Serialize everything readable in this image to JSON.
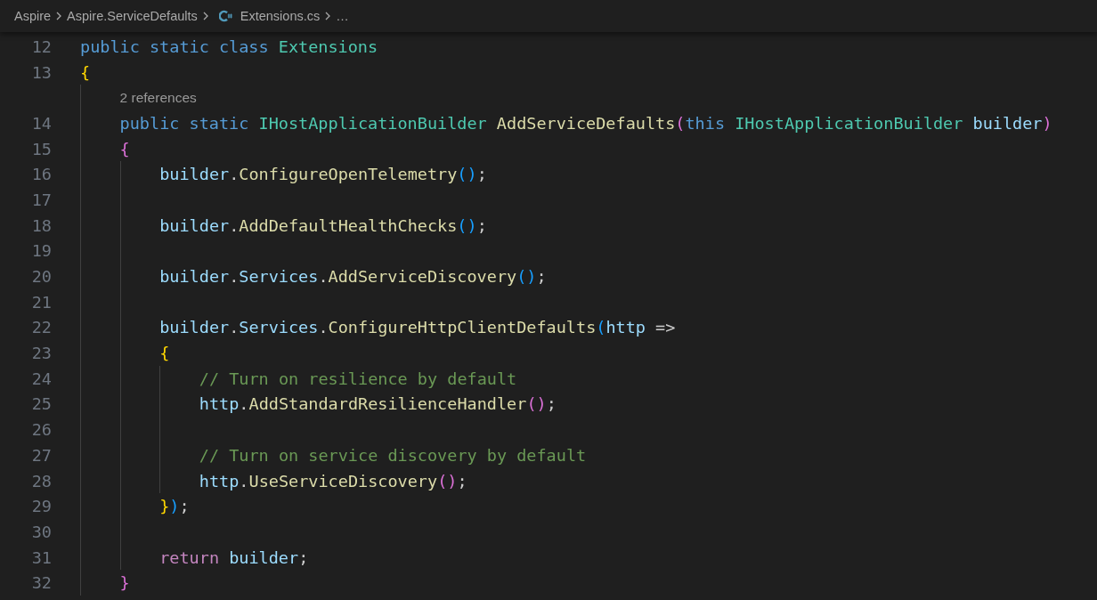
{
  "breadcrumb": {
    "items": [
      {
        "label": "Aspire",
        "kind": "folder"
      },
      {
        "label": "Aspire.ServiceDefaults",
        "kind": "folder"
      },
      {
        "label": "Extensions.cs",
        "kind": "file"
      },
      {
        "label": "…",
        "kind": "more"
      }
    ]
  },
  "editor": {
    "lines": [
      {
        "kind": "code",
        "number": "12",
        "tokens": [
          {
            "kind": "keyword",
            "text": "public static class "
          },
          {
            "kind": "type",
            "text": "Extensions"
          }
        ]
      },
      {
        "kind": "code",
        "number": "13",
        "tokens": [
          {
            "kind": "bracket1",
            "text": "{"
          }
        ]
      },
      {
        "kind": "block",
        "children": [
          {
            "kind": "codelens",
            "text": "2 references"
          },
          {
            "kind": "code",
            "number": "14",
            "tokens": [
              {
                "kind": "keyword",
                "text": "public static "
              },
              {
                "kind": "type",
                "text": "IHostApplicationBuilder"
              },
              {
                "kind": "method",
                "text": " AddServiceDefaults"
              },
              {
                "kind": "bracket2",
                "text": "("
              },
              {
                "kind": "keyword",
                "text": "this "
              },
              {
                "kind": "type",
                "text": "IHostApplicationBuilder"
              },
              {
                "kind": "variable",
                "text": " builder"
              },
              {
                "kind": "bracket2",
                "text": ")"
              }
            ]
          },
          {
            "kind": "code",
            "number": "15",
            "tokens": [
              {
                "kind": "bracket2",
                "text": "{"
              }
            ]
          },
          {
            "kind": "block",
            "children": [
              {
                "kind": "code",
                "number": "16",
                "tokens": [
                  {
                    "kind": "variable",
                    "text": "builder"
                  },
                  {
                    "kind": "plain",
                    "text": "."
                  },
                  {
                    "kind": "method",
                    "text": "ConfigureOpenTelemetry"
                  },
                  {
                    "kind": "bracket3",
                    "text": "()"
                  },
                  {
                    "kind": "plain",
                    "text": ";"
                  }
                ]
              },
              {
                "kind": "blank",
                "number": "17"
              },
              {
                "kind": "code",
                "number": "18",
                "tokens": [
                  {
                    "kind": "variable",
                    "text": "builder"
                  },
                  {
                    "kind": "plain",
                    "text": "."
                  },
                  {
                    "kind": "method",
                    "text": "AddDefaultHealthChecks"
                  },
                  {
                    "kind": "bracket3",
                    "text": "()"
                  },
                  {
                    "kind": "plain",
                    "text": ";"
                  }
                ]
              },
              {
                "kind": "blank",
                "number": "19"
              },
              {
                "kind": "code",
                "number": "20",
                "tokens": [
                  {
                    "kind": "variable",
                    "text": "builder"
                  },
                  {
                    "kind": "plain",
                    "text": "."
                  },
                  {
                    "kind": "variable",
                    "text": "Services"
                  },
                  {
                    "kind": "plain",
                    "text": "."
                  },
                  {
                    "kind": "method",
                    "text": "AddServiceDiscovery"
                  },
                  {
                    "kind": "bracket3",
                    "text": "()"
                  },
                  {
                    "kind": "plain",
                    "text": ";"
                  }
                ]
              },
              {
                "kind": "blank",
                "number": "21"
              },
              {
                "kind": "code",
                "number": "22",
                "tokens": [
                  {
                    "kind": "variable",
                    "text": "builder"
                  },
                  {
                    "kind": "plain",
                    "text": "."
                  },
                  {
                    "kind": "variable",
                    "text": "Services"
                  },
                  {
                    "kind": "plain",
                    "text": "."
                  },
                  {
                    "kind": "method",
                    "text": "ConfigureHttpClientDefaults"
                  },
                  {
                    "kind": "bracket3",
                    "text": "("
                  },
                  {
                    "kind": "variable",
                    "text": "http"
                  },
                  {
                    "kind": "plain",
                    "text": " =>"
                  }
                ]
              },
              {
                "kind": "code",
                "number": "23",
                "tokens": [
                  {
                    "kind": "bracket1",
                    "text": "{"
                  }
                ]
              },
              {
                "kind": "block",
                "children": [
                  {
                    "kind": "code",
                    "number": "24",
                    "tokens": [
                      {
                        "kind": "comment",
                        "text": "// Turn on resilience by default"
                      }
                    ]
                  },
                  {
                    "kind": "code",
                    "number": "25",
                    "tokens": [
                      {
                        "kind": "variable",
                        "text": "http"
                      },
                      {
                        "kind": "plain",
                        "text": "."
                      },
                      {
                        "kind": "method",
                        "text": "AddStandardResilienceHandler"
                      },
                      {
                        "kind": "bracket2",
                        "text": "()"
                      },
                      {
                        "kind": "plain",
                        "text": ";"
                      }
                    ]
                  },
                  {
                    "kind": "blank",
                    "number": "26"
                  },
                  {
                    "kind": "code",
                    "number": "27",
                    "tokens": [
                      {
                        "kind": "comment",
                        "text": "// Turn on service discovery by default"
                      }
                    ]
                  },
                  {
                    "kind": "code",
                    "number": "28",
                    "tokens": [
                      {
                        "kind": "variable",
                        "text": "http"
                      },
                      {
                        "kind": "plain",
                        "text": "."
                      },
                      {
                        "kind": "method",
                        "text": "UseServiceDiscovery"
                      },
                      {
                        "kind": "bracket2",
                        "text": "()"
                      },
                      {
                        "kind": "plain",
                        "text": ";"
                      }
                    ]
                  }
                ]
              },
              {
                "kind": "code",
                "number": "29",
                "tokens": [
                  {
                    "kind": "bracket1",
                    "text": "}"
                  },
                  {
                    "kind": "bracket3",
                    "text": ")"
                  },
                  {
                    "kind": "plain",
                    "text": ";"
                  }
                ]
              },
              {
                "kind": "blank",
                "number": "30"
              },
              {
                "kind": "code",
                "number": "31",
                "tokens": [
                  {
                    "kind": "control",
                    "text": "return "
                  },
                  {
                    "kind": "variable",
                    "text": "builder"
                  },
                  {
                    "kind": "plain",
                    "text": ";"
                  }
                ]
              }
            ]
          },
          {
            "kind": "code",
            "number": "32",
            "tokens": [
              {
                "kind": "bracket2",
                "text": "}"
              }
            ]
          }
        ]
      }
    ]
  }
}
